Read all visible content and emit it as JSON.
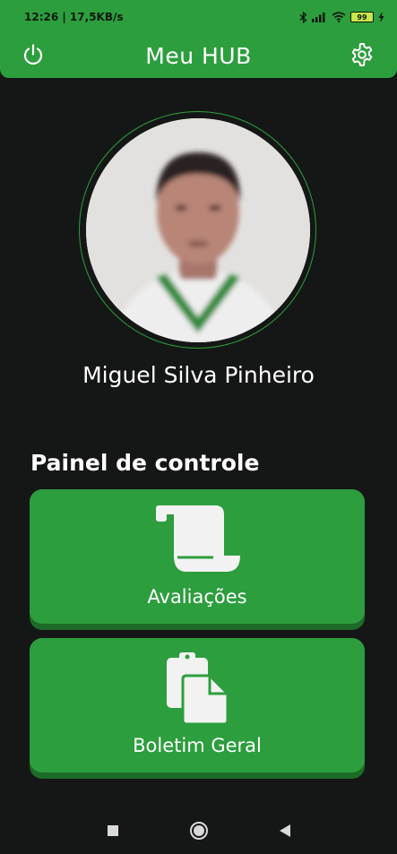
{
  "status_bar": {
    "time_speed": "12:26 | 17,5KB/s",
    "battery_level": "99"
  },
  "header": {
    "title": "Meu HUB"
  },
  "profile": {
    "name": "Miguel Silva Pinheiro"
  },
  "panel": {
    "title": "Painel de controle",
    "cards": [
      {
        "label": "Avaliações",
        "icon": "scroll-icon"
      },
      {
        "label": "Boletim Geral",
        "icon": "clipboard-copy-icon"
      }
    ]
  },
  "colors": {
    "accent": "#2d9e3e",
    "background": "#151716",
    "card_shadow": "#1d6b28"
  }
}
